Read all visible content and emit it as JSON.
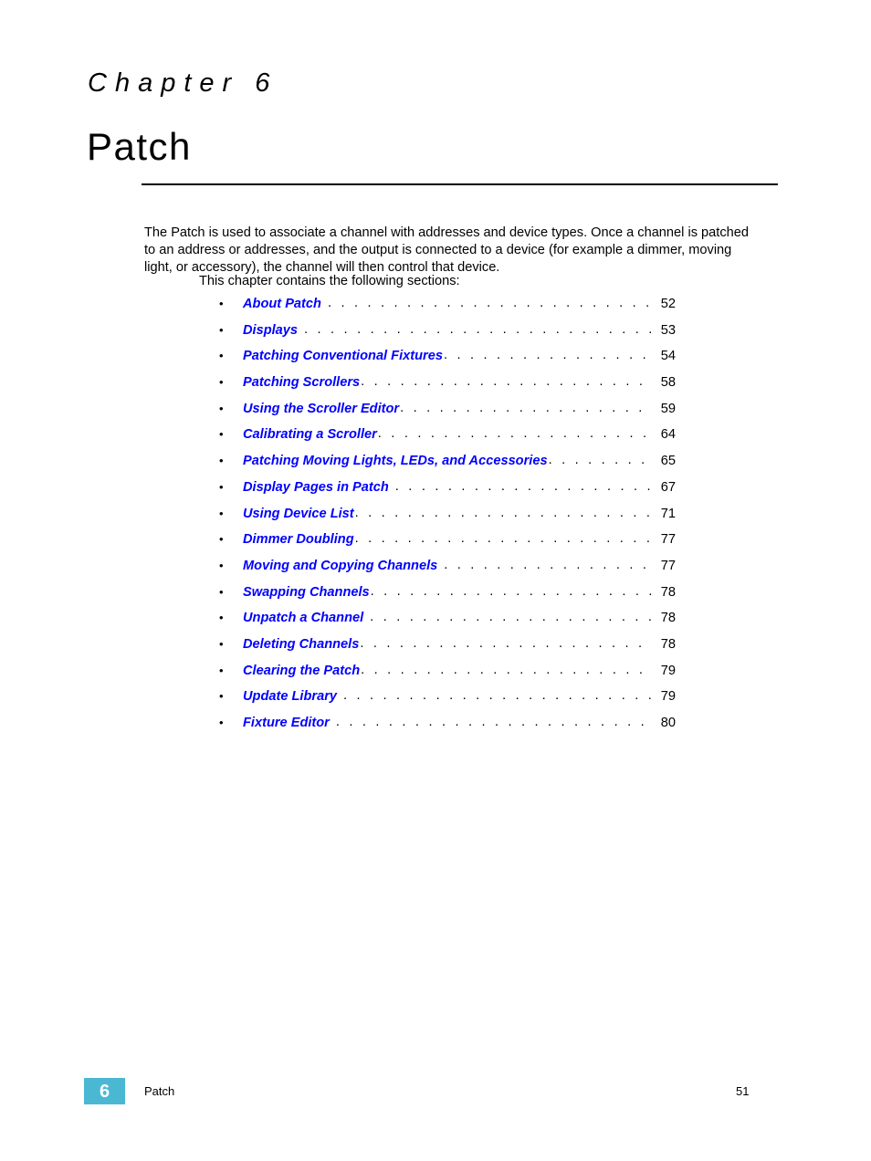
{
  "heading": {
    "eyebrow": "Chapter 6",
    "title": "Patch"
  },
  "intro": {
    "paragraph": "The Patch is used to associate a channel with addresses and device types. Once a channel is patched to an address or addresses, and the output is connected to a device (for example a dimmer, moving light, or accessory), the channel will then control that device.",
    "sections_lead": "This chapter contains the following sections:"
  },
  "toc": {
    "bullet": "•",
    "entries": [
      {
        "label": "About Patch",
        "page": "52",
        "gap": true
      },
      {
        "label": "Displays",
        "page": "53",
        "gap": true
      },
      {
        "label": "Patching Conventional Fixtures",
        "page": "54",
        "gap": false
      },
      {
        "label": "Patching Scrollers",
        "page": "58",
        "gap": false
      },
      {
        "label": "Using the Scroller Editor",
        "page": "59",
        "gap": false
      },
      {
        "label": "Calibrating a Scroller",
        "page": "64",
        "gap": false
      },
      {
        "label": "Patching Moving Lights, LEDs, and Accessories",
        "page": "65",
        "gap": false
      },
      {
        "label": "Display Pages in Patch",
        "page": "67",
        "gap": true
      },
      {
        "label": "Using Device List",
        "page": "71",
        "gap": false
      },
      {
        "label": "Dimmer Doubling",
        "page": "77",
        "gap": false
      },
      {
        "label": "Moving and Copying Channels",
        "page": "77",
        "gap": true
      },
      {
        "label": "Swapping Channels",
        "page": "78",
        "gap": false
      },
      {
        "label": "Unpatch a Channel",
        "page": "78",
        "gap": true
      },
      {
        "label": "Deleting Channels",
        "page": "78",
        "gap": false
      },
      {
        "label": "Clearing the Patch",
        "page": "79",
        "gap": false
      },
      {
        "label": "Update Library",
        "page": "79",
        "gap": true
      },
      {
        "label": "Fixture Editor",
        "page": "80",
        "gap": true
      }
    ]
  },
  "footer": {
    "chapter_number": "6",
    "chapter_label": "Patch",
    "page_number": "51"
  },
  "colors": {
    "link": "#0000ff",
    "badge": "#4bb8d3",
    "text": "#000000"
  }
}
